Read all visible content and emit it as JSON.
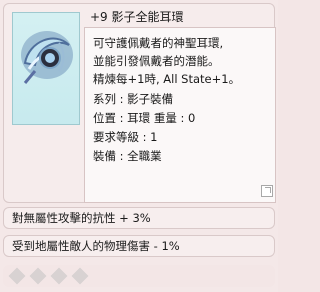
{
  "item": {
    "name": "+9 影子全能耳環",
    "icon": "crescent-earring-icon",
    "description": [
      "可守護佩戴者的神聖耳環,",
      "並能引發佩戴者的潛能。",
      "精煉每+1時, All State+1。",
      "系列 : 影子裝備",
      "位置 : 耳環 重量 : 0",
      "要求等級 : 1",
      "裝備 : 全職業"
    ]
  },
  "effects": [
    "對無屬性攻擊的抗性 + 3%",
    "受到地屬性敵人的物理傷害 - 1%"
  ],
  "slots": [
    "empty-slot",
    "empty-slot",
    "empty-slot",
    "empty-slot"
  ]
}
